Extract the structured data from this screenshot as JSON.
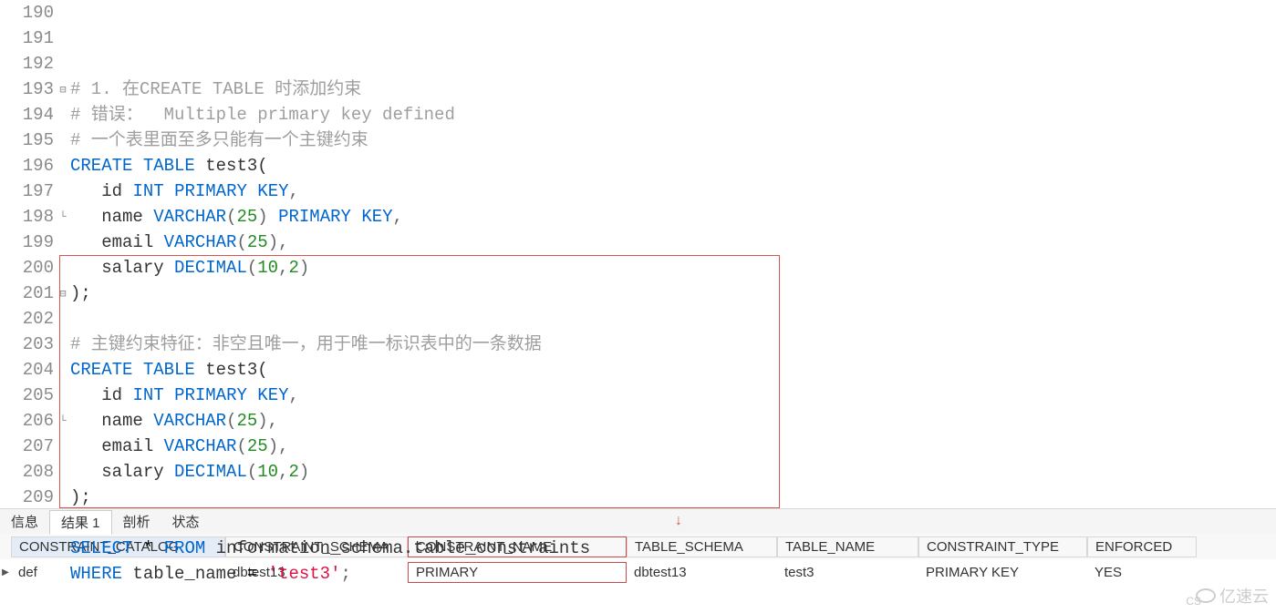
{
  "lineStart": 190,
  "code": [
    {
      "n": 190,
      "tokens": [
        {
          "c": "comment",
          "t": "# 1. 在CREATE TABLE 时添加约束"
        }
      ]
    },
    {
      "n": 191,
      "tokens": [
        {
          "c": "comment",
          "t": "# 错误：  Multiple primary key defined"
        }
      ]
    },
    {
      "n": 192,
      "tokens": [
        {
          "c": "comment",
          "t": "# 一个表里面至多只能有一个主键约束"
        }
      ]
    },
    {
      "n": 193,
      "fold": true,
      "tokens": [
        {
          "c": "keyword",
          "t": "CREATE"
        },
        {
          "c": "",
          "t": " "
        },
        {
          "c": "keyword",
          "t": "TABLE"
        },
        {
          "c": "",
          "t": " "
        },
        {
          "c": "ident",
          "t": "test3("
        }
      ]
    },
    {
      "n": 194,
      "tokens": [
        {
          "c": "",
          "t": "   "
        },
        {
          "c": "ident",
          "t": "id"
        },
        {
          "c": "",
          "t": " "
        },
        {
          "c": "type",
          "t": "INT"
        },
        {
          "c": "",
          "t": " "
        },
        {
          "c": "keyword",
          "t": "PRIMARY"
        },
        {
          "c": "",
          "t": " "
        },
        {
          "c": "keyword",
          "t": "KEY"
        },
        {
          "c": "punct",
          "t": ","
        }
      ]
    },
    {
      "n": 195,
      "tokens": [
        {
          "c": "",
          "t": "   "
        },
        {
          "c": "ident",
          "t": "name"
        },
        {
          "c": "",
          "t": " "
        },
        {
          "c": "type",
          "t": "VARCHAR"
        },
        {
          "c": "punct",
          "t": "("
        },
        {
          "c": "num",
          "t": "25"
        },
        {
          "c": "punct",
          "t": ")"
        },
        {
          "c": "",
          "t": " "
        },
        {
          "c": "keyword",
          "t": "PRIMARY"
        },
        {
          "c": "",
          "t": " "
        },
        {
          "c": "keyword",
          "t": "KEY"
        },
        {
          "c": "punct",
          "t": ","
        }
      ]
    },
    {
      "n": 196,
      "tokens": [
        {
          "c": "",
          "t": "   "
        },
        {
          "c": "ident",
          "t": "email"
        },
        {
          "c": "",
          "t": " "
        },
        {
          "c": "type",
          "t": "VARCHAR"
        },
        {
          "c": "punct",
          "t": "("
        },
        {
          "c": "num",
          "t": "25"
        },
        {
          "c": "punct",
          "t": "),"
        }
      ]
    },
    {
      "n": 197,
      "tokens": [
        {
          "c": "",
          "t": "   "
        },
        {
          "c": "ident",
          "t": "salary"
        },
        {
          "c": "",
          "t": " "
        },
        {
          "c": "type",
          "t": "DECIMAL"
        },
        {
          "c": "punct",
          "t": "("
        },
        {
          "c": "num",
          "t": "10"
        },
        {
          "c": "punct",
          "t": ","
        },
        {
          "c": "num",
          "t": "2"
        },
        {
          "c": "punct",
          "t": ")"
        }
      ]
    },
    {
      "n": 198,
      "foldEnd": true,
      "tokens": [
        {
          "c": "ident",
          "t": ");"
        }
      ]
    },
    {
      "n": 199,
      "tokens": []
    },
    {
      "n": 200,
      "tokens": [
        {
          "c": "comment",
          "t": "# 主键约束特征：非空且唯一，用于唯一标识表中的一条数据"
        }
      ]
    },
    {
      "n": 201,
      "fold": true,
      "tokens": [
        {
          "c": "keyword",
          "t": "CREATE"
        },
        {
          "c": "",
          "t": " "
        },
        {
          "c": "keyword",
          "t": "TABLE"
        },
        {
          "c": "",
          "t": " "
        },
        {
          "c": "ident",
          "t": "test3("
        }
      ]
    },
    {
      "n": 202,
      "tokens": [
        {
          "c": "",
          "t": "   "
        },
        {
          "c": "ident",
          "t": "id"
        },
        {
          "c": "",
          "t": " "
        },
        {
          "c": "type",
          "t": "INT"
        },
        {
          "c": "",
          "t": " "
        },
        {
          "c": "keyword",
          "t": "PRIMARY"
        },
        {
          "c": "",
          "t": " "
        },
        {
          "c": "keyword",
          "t": "KEY"
        },
        {
          "c": "punct",
          "t": ","
        }
      ]
    },
    {
      "n": 203,
      "tokens": [
        {
          "c": "",
          "t": "   "
        },
        {
          "c": "ident",
          "t": "name"
        },
        {
          "c": "",
          "t": " "
        },
        {
          "c": "type",
          "t": "VARCHAR"
        },
        {
          "c": "punct",
          "t": "("
        },
        {
          "c": "num",
          "t": "25"
        },
        {
          "c": "punct",
          "t": "),"
        }
      ]
    },
    {
      "n": 204,
      "tokens": [
        {
          "c": "",
          "t": "   "
        },
        {
          "c": "ident",
          "t": "email"
        },
        {
          "c": "",
          "t": " "
        },
        {
          "c": "type",
          "t": "VARCHAR"
        },
        {
          "c": "punct",
          "t": "("
        },
        {
          "c": "num",
          "t": "25"
        },
        {
          "c": "punct",
          "t": "),"
        }
      ]
    },
    {
      "n": 205,
      "tokens": [
        {
          "c": "",
          "t": "   "
        },
        {
          "c": "ident",
          "t": "salary"
        },
        {
          "c": "",
          "t": " "
        },
        {
          "c": "type",
          "t": "DECIMAL"
        },
        {
          "c": "punct",
          "t": "("
        },
        {
          "c": "num",
          "t": "10"
        },
        {
          "c": "punct",
          "t": ","
        },
        {
          "c": "num",
          "t": "2"
        },
        {
          "c": "punct",
          "t": ")"
        }
      ]
    },
    {
      "n": 206,
      "foldEnd": true,
      "tokens": [
        {
          "c": "ident",
          "t": ");"
        }
      ]
    },
    {
      "n": 207,
      "tokens": []
    },
    {
      "n": 208,
      "tokens": [
        {
          "c": "keyword",
          "t": "SELECT"
        },
        {
          "c": "",
          "t": " * "
        },
        {
          "c": "keyword",
          "t": "FROM"
        },
        {
          "c": "",
          "t": " "
        },
        {
          "c": "ident",
          "t": "information_schema.table_constraints"
        }
      ]
    },
    {
      "n": 209,
      "tokens": [
        {
          "c": "keyword",
          "t": "WHERE"
        },
        {
          "c": "",
          "t": " "
        },
        {
          "c": "ident",
          "t": "table_name"
        },
        {
          "c": "",
          "t": " = "
        },
        {
          "c": "str",
          "t": "'test3'"
        },
        {
          "c": "punct",
          "t": ";"
        }
      ]
    }
  ],
  "tabs": {
    "items": [
      "信息",
      "结果 1",
      "剖析",
      "状态"
    ],
    "activeIndex": 1
  },
  "grid": {
    "headers": [
      "CONSTRAINT_CATALOG",
      "CONSTRAINT_SCHEMA",
      "CONSTRAINT_NAME",
      "TABLE_SCHEMA",
      "TABLE_NAME",
      "CONSTRAINT_TYPE",
      "ENFORCED"
    ],
    "outlinedHeaderIndex": 2,
    "selectedHeaderIndex": 0,
    "rows": [
      [
        "def",
        "dbtest13",
        "PRIMARY",
        "dbtest13",
        "test3",
        "PRIMARY KEY",
        "YES"
      ]
    ],
    "outlinedCellCol": 2
  },
  "watermark": "亿速云",
  "csMark": "CS"
}
